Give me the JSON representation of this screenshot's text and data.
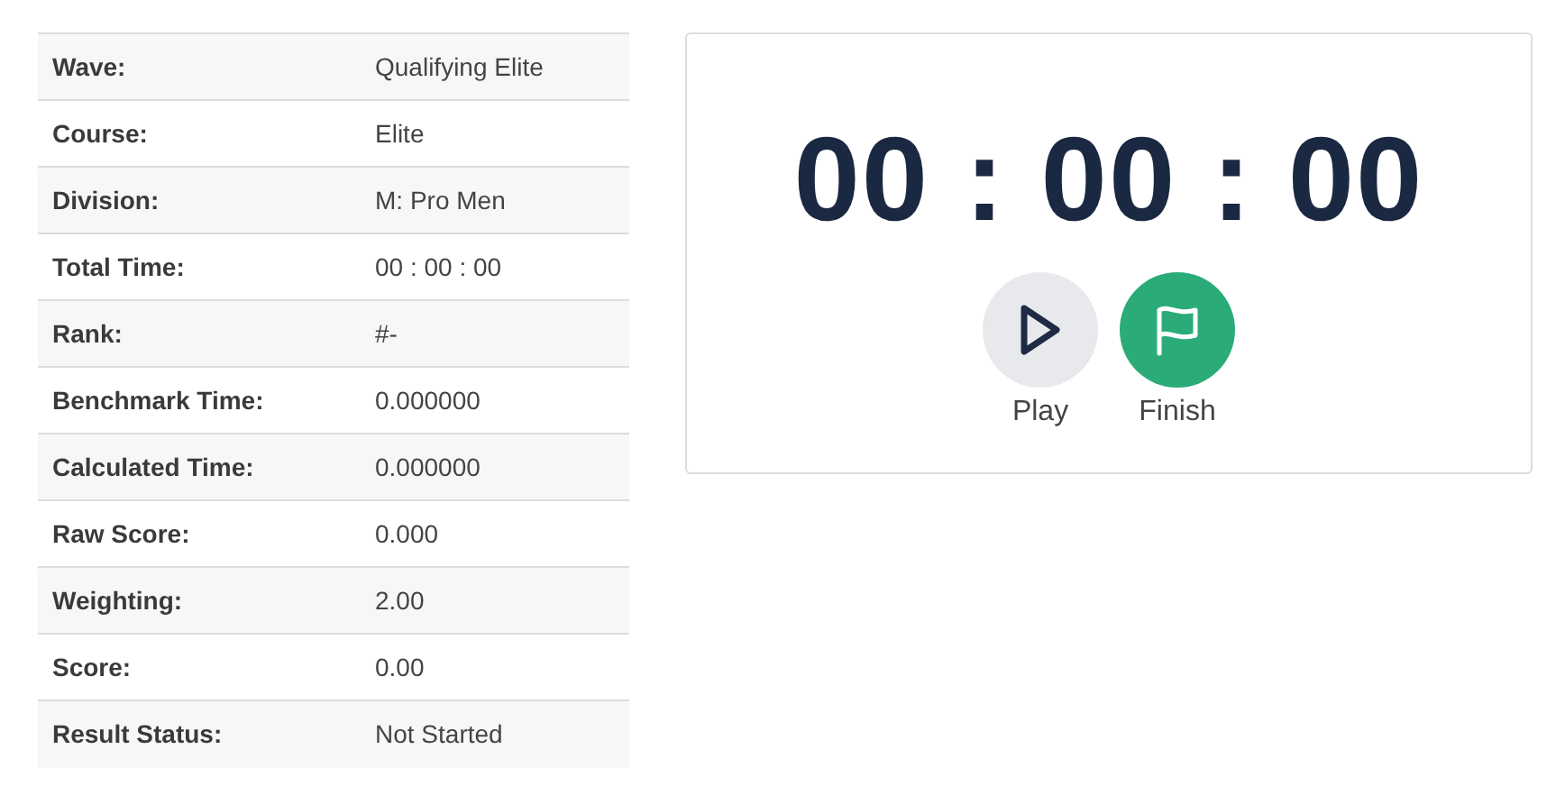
{
  "details": [
    {
      "label": "Wave:",
      "value": "Qualifying Elite"
    },
    {
      "label": "Course:",
      "value": "Elite"
    },
    {
      "label": "Division:",
      "value": "M: Pro Men"
    },
    {
      "label": "Total Time:",
      "value": "00 : 00 : 00"
    },
    {
      "label": "Rank:",
      "value": "#-"
    },
    {
      "label": "Benchmark Time:",
      "value": "0.000000"
    },
    {
      "label": "Calculated Time:",
      "value": "0.000000"
    },
    {
      "label": "Raw Score:",
      "value": "0.000"
    },
    {
      "label": "Weighting:",
      "value": "2.00"
    },
    {
      "label": "Score:",
      "value": "0.00"
    },
    {
      "label": "Result Status:",
      "value": "Not Started"
    }
  ],
  "timer": {
    "display": "00 : 00 : 00",
    "buttons": [
      {
        "kind": "play",
        "label": "Play"
      },
      {
        "kind": "finish",
        "label": "Finish"
      }
    ]
  }
}
